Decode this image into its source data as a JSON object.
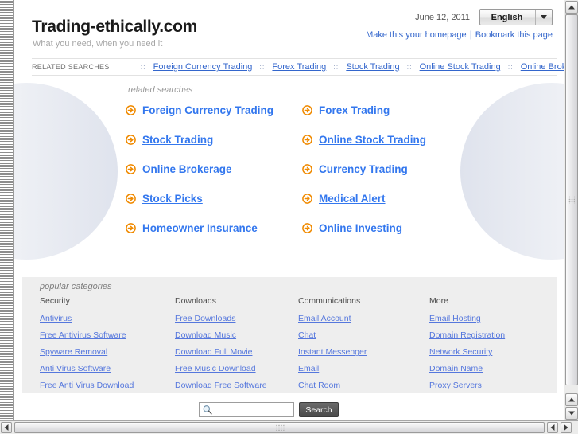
{
  "header": {
    "site_title": "Trading-ethically.com",
    "tagline": "What you need, when you need it",
    "date": "June 12, 2011",
    "language_value": "English",
    "language_icon": "chevron-down-icon",
    "homepage_link": "Make this your homepage",
    "separator": "|",
    "bookmark_link": "Bookmark this page"
  },
  "related_strip": {
    "label": "RELATED SEARCHES",
    "dots": "::",
    "links": [
      "Foreign Currency Trading",
      "Forex Trading",
      "Stock Trading",
      "Online Stock Trading",
      "Online Brokerage"
    ]
  },
  "related_main": {
    "heading": "related searches",
    "arrow_icon": "arrow-circle-right-icon",
    "items": [
      "Foreign Currency Trading",
      "Forex Trading",
      "Stock Trading",
      "Online Stock Trading",
      "Online Brokerage",
      "Currency Trading",
      "Stock Picks",
      "Medical Alert",
      "Homeowner Insurance",
      "Online Investing"
    ]
  },
  "popular_categories": {
    "heading": "popular categories",
    "columns": [
      {
        "title": "Security",
        "links": [
          "Antivirus",
          "Free Antivirus Software",
          "Spyware Removal",
          "Anti Virus Software",
          "Free Anti Virus Download"
        ]
      },
      {
        "title": "Downloads",
        "links": [
          "Free Downloads",
          "Download Music",
          "Download Full Movie",
          "Free Music Download",
          "Download Free Software"
        ]
      },
      {
        "title": "Communications",
        "links": [
          "Email Account",
          "Chat",
          "Instant Messenger",
          "Email",
          "Chat Room"
        ]
      },
      {
        "title": "More",
        "links": [
          "Email Hosting",
          "Domain Registration",
          "Network Security",
          "Domain Name",
          "Proxy Servers"
        ]
      }
    ]
  },
  "search": {
    "icon": "magnifier-icon",
    "value": "",
    "placeholder": "",
    "button_label": "Search"
  },
  "scrollbars": {
    "v_up_icon": "scroll-up-arrow-icon",
    "v_down_icon": "scroll-down-arrow-icon",
    "h_left_icon": "scroll-left-arrow-icon",
    "h_right_icon": "scroll-right-arrow-icon"
  },
  "colors": {
    "link_blue": "#3366cc",
    "main_link_blue": "#3377ee",
    "arrow_orange": "#f08a00",
    "category_bg": "#eeeeee"
  }
}
